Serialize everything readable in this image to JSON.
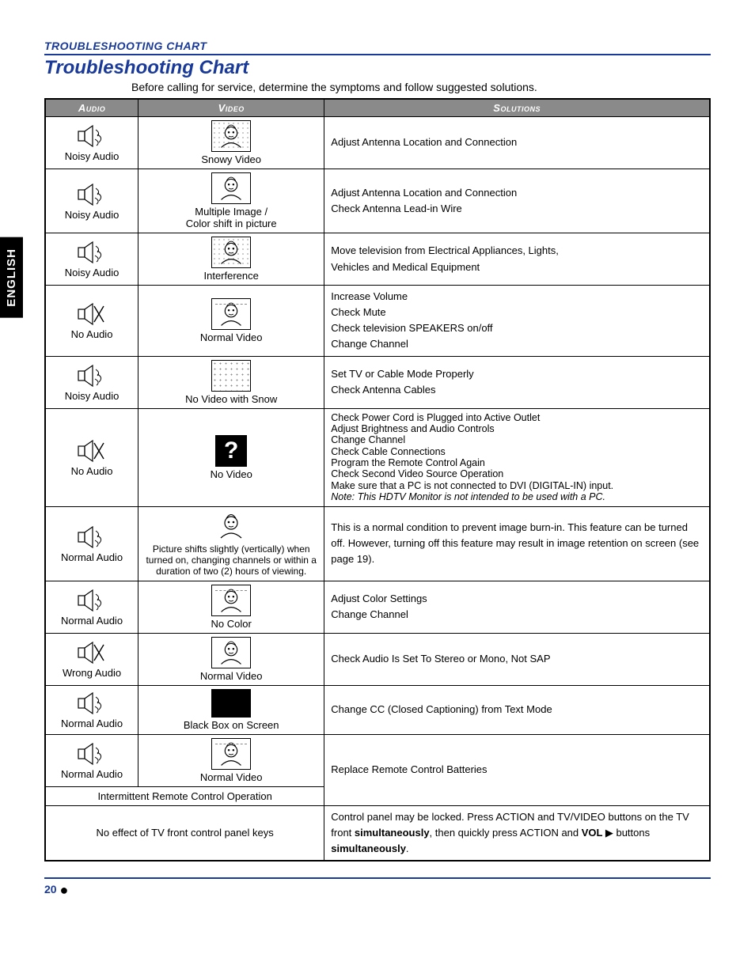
{
  "sidebar": {
    "language": "ENGLISH"
  },
  "section_header": "TROUBLESHOOTING CHART",
  "title": "Troubleshooting Chart",
  "intro": "Before calling for service, determine the symptoms and follow suggested solutions.",
  "headers": {
    "audio": "Audio",
    "video": "Video",
    "solutions": "Solutions"
  },
  "rows": [
    {
      "audio": {
        "label": "Noisy Audio",
        "icon": "speaker-noisy"
      },
      "video": {
        "label": "Snowy Video",
        "icon": "head-snowy"
      },
      "solutions": [
        "Adjust Antenna Location and Connection"
      ]
    },
    {
      "audio": {
        "label": "Noisy Audio",
        "icon": "speaker-noisy"
      },
      "video": {
        "label": "Multiple Image /\nColor shift in picture",
        "icon": "head-rect"
      },
      "solutions": [
        "Adjust Antenna Location and Connection",
        "Check Antenna Lead-in Wire"
      ]
    },
    {
      "audio": {
        "label": "Noisy Audio",
        "icon": "speaker-noisy"
      },
      "video": {
        "label": "Interference",
        "icon": "head-snowy"
      },
      "solutions": [
        "Move television from Electrical Appliances, Lights,",
        "Vehicles and Medical Equipment"
      ]
    },
    {
      "audio": {
        "label": "No Audio",
        "icon": "speaker-x"
      },
      "video": {
        "label": "Normal Video",
        "icon": "head-rect-dash"
      },
      "solutions": [
        "Increase Volume",
        "Check Mute",
        "Check television SPEAKERS on/off",
        "Change Channel"
      ]
    },
    {
      "audio": {
        "label": "Noisy Audio",
        "icon": "speaker-noisy"
      },
      "video": {
        "label": "No Video with Snow",
        "icon": "snow-only"
      },
      "solutions": [
        "Set TV or Cable Mode Properly",
        "Check Antenna Cables"
      ]
    },
    {
      "audio": {
        "label": "No Audio",
        "icon": "speaker-x"
      },
      "video": {
        "label": "No Video",
        "icon": "question-box"
      },
      "solutions_tight": [
        "Check Power Cord is Plugged into Active Outlet",
        "Adjust Brightness and Audio Controls",
        "Change Channel",
        "Check Cable Connections",
        "Program the Remote Control Again",
        "Check Second Video Source Operation",
        "Make sure that a PC is not connected to DVI (DIGITAL-IN) input."
      ],
      "solutions_italic": "Note: This HDTV Monitor is not intended to be used with a PC."
    },
    {
      "audio": {
        "label": "Normal Audio",
        "icon": "speaker-noisy"
      },
      "video": {
        "label": "Picture shifts slightly (vertically) when turned on, changing channels or within a duration of two (2) hours of viewing.",
        "icon": "head-plain"
      },
      "solutions": [
        "This is a normal condition to prevent image burn-in. This feature can be turned off. However, turning off this feature may result in image retention on screen (see page 19)."
      ]
    },
    {
      "audio": {
        "label": "Normal Audio",
        "icon": "speaker-noisy"
      },
      "video": {
        "label": "No Color",
        "icon": "head-rect-dash"
      },
      "solutions": [
        "Adjust Color Settings",
        "Change Channel"
      ]
    },
    {
      "audio": {
        "label": "Wrong Audio",
        "icon": "speaker-x"
      },
      "video": {
        "label": "Normal Video",
        "icon": "head-rect"
      },
      "solutions": [
        "Check Audio Is Set To Stereo or Mono, Not SAP"
      ]
    },
    {
      "audio": {
        "label": "Normal Audio",
        "icon": "speaker-noisy"
      },
      "video": {
        "label": "Black Box on Screen",
        "icon": "black-box"
      },
      "solutions": [
        "Change CC (Closed Captioning) from Text Mode"
      ]
    },
    {
      "audio": {
        "label": "Normal Audio",
        "icon": "speaker-noisy"
      },
      "video": {
        "label": "Normal Video",
        "icon": "head-rect-dash"
      },
      "span_label": "Intermittent Remote Control Operation",
      "solutions": [
        "Replace Remote Control Batteries"
      ]
    },
    {
      "span_only": "No effect of TV front control panel keys",
      "solutions_rich": {
        "pre": "Control panel may be locked. Press ACTION and TV/VIDEO buttons on the TV front ",
        "b1": "simultaneously",
        "mid": ", then quickly press ACTION and ",
        "b2": "VOL ",
        "tri": "▶",
        "post": " buttons ",
        "b3": "simultaneously",
        "end": "."
      }
    }
  ],
  "footer": {
    "page": "20"
  }
}
